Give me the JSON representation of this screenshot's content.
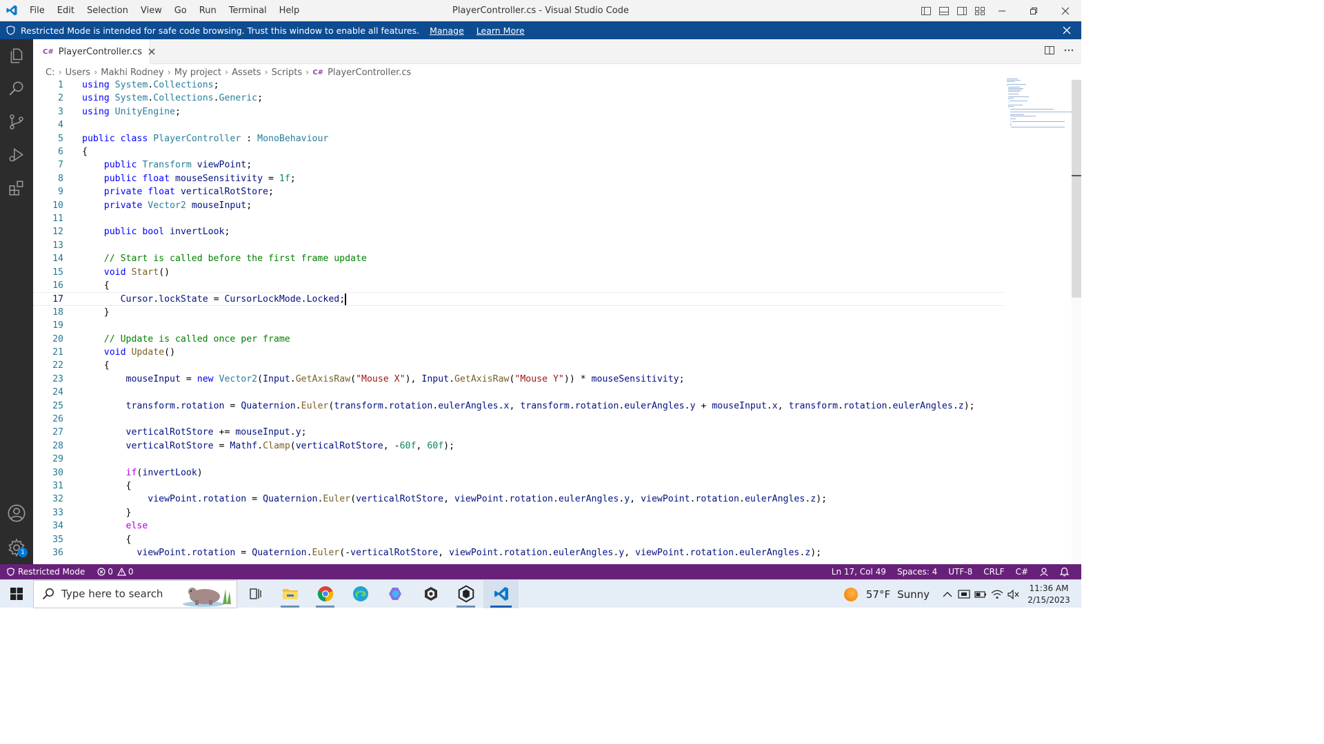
{
  "window": {
    "title": "PlayerController.cs - Visual Studio Code",
    "menu": [
      "File",
      "Edit",
      "Selection",
      "View",
      "Go",
      "Run",
      "Terminal",
      "Help"
    ]
  },
  "banner": {
    "message": "Restricted Mode is intended for safe code browsing. Trust this window to enable all features.",
    "manage_link": "Manage",
    "learn_more_link": "Learn More"
  },
  "tab": {
    "icon_text": "C#",
    "label": "PlayerController.cs"
  },
  "breadcrumb": {
    "parts": [
      "C:",
      "Users",
      "Makhi Rodney",
      "My project",
      "Assets",
      "Scripts"
    ],
    "file_icon_text": "C#",
    "file": "PlayerController.cs"
  },
  "editor": {
    "current_line": 17,
    "lines": [
      [
        [
          "kw",
          "using"
        ],
        [
          "txt",
          " "
        ],
        [
          "type",
          "System"
        ],
        [
          "txt",
          "."
        ],
        [
          "type",
          "Collections"
        ],
        [
          "txt",
          ";"
        ]
      ],
      [
        [
          "kw",
          "using"
        ],
        [
          "txt",
          " "
        ],
        [
          "type",
          "System"
        ],
        [
          "txt",
          "."
        ],
        [
          "type",
          "Collections"
        ],
        [
          "txt",
          "."
        ],
        [
          "type",
          "Generic"
        ],
        [
          "txt",
          ";"
        ]
      ],
      [
        [
          "kw",
          "using"
        ],
        [
          "txt",
          " "
        ],
        [
          "type",
          "UnityEngine"
        ],
        [
          "txt",
          ";"
        ]
      ],
      [],
      [
        [
          "kw",
          "public"
        ],
        [
          "txt",
          " "
        ],
        [
          "kw",
          "class"
        ],
        [
          "txt",
          " "
        ],
        [
          "type",
          "PlayerController"
        ],
        [
          "txt",
          " : "
        ],
        [
          "type",
          "MonoBehaviour"
        ]
      ],
      [
        [
          "txt",
          "{"
        ]
      ],
      [
        [
          "txt",
          "    "
        ],
        [
          "kw",
          "public"
        ],
        [
          "txt",
          " "
        ],
        [
          "type",
          "Transform"
        ],
        [
          "txt",
          " "
        ],
        [
          "var",
          "viewPoint"
        ],
        [
          "txt",
          ";"
        ]
      ],
      [
        [
          "txt",
          "    "
        ],
        [
          "kw",
          "public"
        ],
        [
          "txt",
          " "
        ],
        [
          "kw",
          "float"
        ],
        [
          "txt",
          " "
        ],
        [
          "var",
          "mouseSensitivity"
        ],
        [
          "txt",
          " = "
        ],
        [
          "num",
          "1f"
        ],
        [
          "txt",
          ";"
        ]
      ],
      [
        [
          "txt",
          "    "
        ],
        [
          "kw",
          "private"
        ],
        [
          "txt",
          " "
        ],
        [
          "kw",
          "float"
        ],
        [
          "txt",
          " "
        ],
        [
          "var",
          "verticalRotStore"
        ],
        [
          "txt",
          ";"
        ]
      ],
      [
        [
          "txt",
          "    "
        ],
        [
          "kw",
          "private"
        ],
        [
          "txt",
          " "
        ],
        [
          "type",
          "Vector2"
        ],
        [
          "txt",
          " "
        ],
        [
          "var",
          "mouseInput"
        ],
        [
          "txt",
          ";"
        ]
      ],
      [],
      [
        [
          "txt",
          "    "
        ],
        [
          "kw",
          "public"
        ],
        [
          "txt",
          " "
        ],
        [
          "kw",
          "bool"
        ],
        [
          "txt",
          " "
        ],
        [
          "var",
          "invertLook"
        ],
        [
          "txt",
          ";"
        ]
      ],
      [],
      [
        [
          "txt",
          "    "
        ],
        [
          "com",
          "// Start is called before the first frame update"
        ]
      ],
      [
        [
          "txt",
          "    "
        ],
        [
          "kw",
          "void"
        ],
        [
          "txt",
          " "
        ],
        [
          "fn",
          "Start"
        ],
        [
          "txt",
          "()"
        ]
      ],
      [
        [
          "txt",
          "    {"
        ]
      ],
      [
        [
          "txt",
          "       "
        ],
        [
          "var",
          "Cursor"
        ],
        [
          "txt",
          "."
        ],
        [
          "var",
          "lockState"
        ],
        [
          "txt",
          " = "
        ],
        [
          "var",
          "CursorLockMode"
        ],
        [
          "txt",
          "."
        ],
        [
          "var",
          "Locked"
        ],
        [
          "txt",
          ";"
        ]
      ],
      [
        [
          "txt",
          "    }"
        ]
      ],
      [],
      [
        [
          "txt",
          "    "
        ],
        [
          "com",
          "// Update is called once per frame"
        ]
      ],
      [
        [
          "txt",
          "    "
        ],
        [
          "kw",
          "void"
        ],
        [
          "txt",
          " "
        ],
        [
          "fn",
          "Update"
        ],
        [
          "txt",
          "()"
        ]
      ],
      [
        [
          "txt",
          "    {"
        ]
      ],
      [
        [
          "txt",
          "        "
        ],
        [
          "var",
          "mouseInput"
        ],
        [
          "txt",
          " = "
        ],
        [
          "kw",
          "new"
        ],
        [
          "txt",
          " "
        ],
        [
          "type",
          "Vector2"
        ],
        [
          "txt",
          "("
        ],
        [
          "var",
          "Input"
        ],
        [
          "txt",
          "."
        ],
        [
          "fn",
          "GetAxisRaw"
        ],
        [
          "txt",
          "("
        ],
        [
          "str",
          "\"Mouse X\""
        ],
        [
          "txt",
          "), "
        ],
        [
          "var",
          "Input"
        ],
        [
          "txt",
          "."
        ],
        [
          "fn",
          "GetAxisRaw"
        ],
        [
          "txt",
          "("
        ],
        [
          "str",
          "\"Mouse Y\""
        ],
        [
          "txt",
          ")) * "
        ],
        [
          "var",
          "mouseSensitivity"
        ],
        [
          "txt",
          ";"
        ]
      ],
      [],
      [
        [
          "txt",
          "        "
        ],
        [
          "var",
          "transform"
        ],
        [
          "txt",
          "."
        ],
        [
          "var",
          "rotation"
        ],
        [
          "txt",
          " = "
        ],
        [
          "var",
          "Quaternion"
        ],
        [
          "txt",
          "."
        ],
        [
          "fn",
          "Euler"
        ],
        [
          "txt",
          "("
        ],
        [
          "var",
          "transform"
        ],
        [
          "txt",
          "."
        ],
        [
          "var",
          "rotation"
        ],
        [
          "txt",
          "."
        ],
        [
          "var",
          "eulerAngles"
        ],
        [
          "txt",
          "."
        ],
        [
          "var",
          "x"
        ],
        [
          "txt",
          ", "
        ],
        [
          "var",
          "transform"
        ],
        [
          "txt",
          "."
        ],
        [
          "var",
          "rotation"
        ],
        [
          "txt",
          "."
        ],
        [
          "var",
          "eulerAngles"
        ],
        [
          "txt",
          "."
        ],
        [
          "var",
          "y"
        ],
        [
          "txt",
          " + "
        ],
        [
          "var",
          "mouseInput"
        ],
        [
          "txt",
          "."
        ],
        [
          "var",
          "x"
        ],
        [
          "txt",
          ", "
        ],
        [
          "var",
          "transform"
        ],
        [
          "txt",
          "."
        ],
        [
          "var",
          "rotation"
        ],
        [
          "txt",
          "."
        ],
        [
          "var",
          "eulerAngles"
        ],
        [
          "txt",
          "."
        ],
        [
          "var",
          "z"
        ],
        [
          "txt",
          ");"
        ]
      ],
      [],
      [
        [
          "txt",
          "        "
        ],
        [
          "var",
          "verticalRotStore"
        ],
        [
          "txt",
          " += "
        ],
        [
          "var",
          "mouseInput"
        ],
        [
          "txt",
          "."
        ],
        [
          "var",
          "y"
        ],
        [
          "txt",
          ";"
        ]
      ],
      [
        [
          "txt",
          "        "
        ],
        [
          "var",
          "verticalRotStore"
        ],
        [
          "txt",
          " = "
        ],
        [
          "var",
          "Mathf"
        ],
        [
          "txt",
          "."
        ],
        [
          "fn",
          "Clamp"
        ],
        [
          "txt",
          "("
        ],
        [
          "var",
          "verticalRotStore"
        ],
        [
          "txt",
          ", -"
        ],
        [
          "num",
          "60f"
        ],
        [
          "txt",
          ", "
        ],
        [
          "num",
          "60f"
        ],
        [
          "txt",
          ");"
        ]
      ],
      [],
      [
        [
          "txt",
          "        "
        ],
        [
          "ctrl",
          "if"
        ],
        [
          "txt",
          "("
        ],
        [
          "var",
          "invertLook"
        ],
        [
          "txt",
          ")"
        ]
      ],
      [
        [
          "txt",
          "        {"
        ]
      ],
      [
        [
          "txt",
          "            "
        ],
        [
          "var",
          "viewPoint"
        ],
        [
          "txt",
          "."
        ],
        [
          "var",
          "rotation"
        ],
        [
          "txt",
          " = "
        ],
        [
          "var",
          "Quaternion"
        ],
        [
          "txt",
          "."
        ],
        [
          "fn",
          "Euler"
        ],
        [
          "txt",
          "("
        ],
        [
          "var",
          "verticalRotStore"
        ],
        [
          "txt",
          ", "
        ],
        [
          "var",
          "viewPoint"
        ],
        [
          "txt",
          "."
        ],
        [
          "var",
          "rotation"
        ],
        [
          "txt",
          "."
        ],
        [
          "var",
          "eulerAngles"
        ],
        [
          "txt",
          "."
        ],
        [
          "var",
          "y"
        ],
        [
          "txt",
          ", "
        ],
        [
          "var",
          "viewPoint"
        ],
        [
          "txt",
          "."
        ],
        [
          "var",
          "rotation"
        ],
        [
          "txt",
          "."
        ],
        [
          "var",
          "eulerAngles"
        ],
        [
          "txt",
          "."
        ],
        [
          "var",
          "z"
        ],
        [
          "txt",
          ");"
        ]
      ],
      [
        [
          "txt",
          "        }"
        ]
      ],
      [
        [
          "txt",
          "        "
        ],
        [
          "ctrl",
          "else"
        ]
      ],
      [
        [
          "txt",
          "        {"
        ]
      ],
      [
        [
          "txt",
          "          "
        ],
        [
          "var",
          "viewPoint"
        ],
        [
          "txt",
          "."
        ],
        [
          "var",
          "rotation"
        ],
        [
          "txt",
          " = "
        ],
        [
          "var",
          "Quaternion"
        ],
        [
          "txt",
          "."
        ],
        [
          "fn",
          "Euler"
        ],
        [
          "txt",
          "(-"
        ],
        [
          "var",
          "verticalRotStore"
        ],
        [
          "txt",
          ", "
        ],
        [
          "var",
          "viewPoint"
        ],
        [
          "txt",
          "."
        ],
        [
          "var",
          "rotation"
        ],
        [
          "txt",
          "."
        ],
        [
          "var",
          "eulerAngles"
        ],
        [
          "txt",
          "."
        ],
        [
          "var",
          "y"
        ],
        [
          "txt",
          ", "
        ],
        [
          "var",
          "viewPoint"
        ],
        [
          "txt",
          "."
        ],
        [
          "var",
          "rotation"
        ],
        [
          "txt",
          "."
        ],
        [
          "var",
          "eulerAngles"
        ],
        [
          "txt",
          "."
        ],
        [
          "var",
          "z"
        ],
        [
          "txt",
          ");"
        ]
      ]
    ]
  },
  "statusbar": {
    "restricted": "Restricted Mode",
    "errors": "0",
    "warnings": "0",
    "position": "Ln 17, Col 49",
    "spaces": "Spaces: 4",
    "encoding": "UTF-8",
    "eol": "CRLF",
    "language": "C#",
    "settings_badge": "1"
  },
  "taskbar": {
    "search_placeholder": "Type here to search",
    "weather_temp": "57°F",
    "weather_condition": "Sunny",
    "time": "11:36 AM",
    "date": "2/15/2023"
  },
  "colors": {
    "statusbar": "#68217a",
    "banner": "#0e4c92",
    "activitybar": "#2c2c2c"
  }
}
